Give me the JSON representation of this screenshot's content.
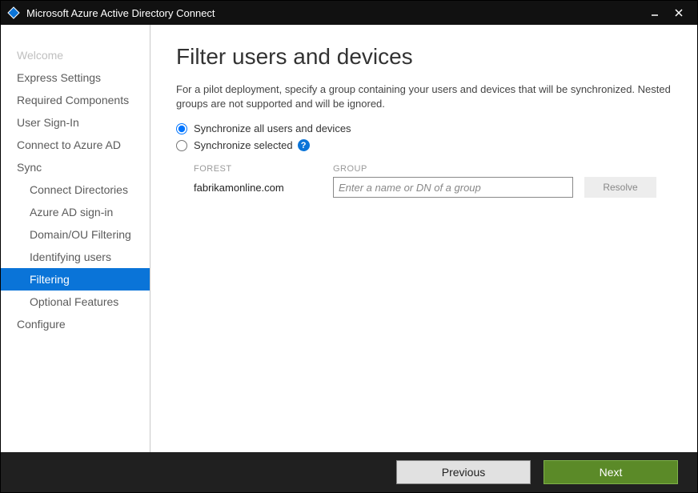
{
  "window": {
    "title": "Microsoft Azure Active Directory Connect"
  },
  "sidebar": {
    "items": [
      {
        "label": "Welcome",
        "state": "disabled"
      },
      {
        "label": "Express Settings",
        "state": "normal"
      },
      {
        "label": "Required Components",
        "state": "normal"
      },
      {
        "label": "User Sign-In",
        "state": "normal"
      },
      {
        "label": "Connect to Azure AD",
        "state": "normal"
      },
      {
        "label": "Sync",
        "state": "normal"
      },
      {
        "label": "Connect Directories",
        "state": "normal",
        "sub": true
      },
      {
        "label": "Azure AD sign-in",
        "state": "normal",
        "sub": true
      },
      {
        "label": "Domain/OU Filtering",
        "state": "normal",
        "sub": true
      },
      {
        "label": "Identifying users",
        "state": "normal",
        "sub": true
      },
      {
        "label": "Filtering",
        "state": "selected",
        "sub": true
      },
      {
        "label": "Optional Features",
        "state": "normal",
        "sub": true
      },
      {
        "label": "Configure",
        "state": "normal"
      }
    ]
  },
  "content": {
    "heading": "Filter users and devices",
    "description": "For a pilot deployment, specify a group containing your users and devices that will be synchronized. Nested groups are not supported and will be ignored.",
    "option_all": "Synchronize all users and devices",
    "option_selected": "Synchronize selected",
    "form": {
      "forest_label": "FOREST",
      "group_label": "GROUP",
      "forest_value": "fabrikamonline.com",
      "group_placeholder": "Enter a name or DN of a group",
      "resolve_label": "Resolve"
    }
  },
  "footer": {
    "previous": "Previous",
    "next": "Next"
  }
}
